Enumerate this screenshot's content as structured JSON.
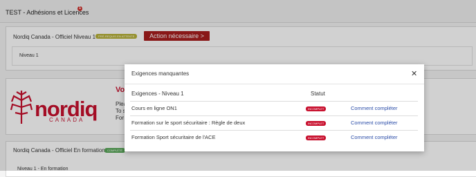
{
  "header": {
    "title": "TEST - Adhésions et Licences",
    "notif_count": "1"
  },
  "card1": {
    "title": "Nordiq Canada - Officiel Niveau 1",
    "badge": "PRÉ-REQUIS EN ATTENTE",
    "action_label": "Action nécessaire >",
    "sub_label": "Niveau 1"
  },
  "promo": {
    "logo_word": "nordiq",
    "logo_sub": "CANADA",
    "title_fragment": "Vo",
    "line1": "Plea",
    "line2": "To s",
    "line3": "For"
  },
  "card3": {
    "title": "Nordiq Canada - Officiel En formation",
    "badge": "COMPLÉTÉ",
    "sub_label": "Niveau 1 - En formation"
  },
  "modal": {
    "title": "Exigences manquantes",
    "col_requirements": "Exigences - Niveau 1",
    "col_status": "Statut",
    "rows": [
      {
        "label": "Cours en ligne ON1",
        "status": "INCOMPLET",
        "link": "Comment compléter"
      },
      {
        "label": "Formation sur le sport sécuritaire : Règle de deux",
        "status": "INCOMPLET",
        "link": "Comment compléter"
      },
      {
        "label": "Formation Sport sécuritaire de l'ACE",
        "status": "INCOMPLET",
        "link": "Comment compléter"
      }
    ]
  },
  "colors": {
    "brand_red": "#c8102e",
    "link_blue": "#2b4da8",
    "wait_badge": "#b7b13a",
    "complete_badge": "#5aa85a"
  },
  "icons": {
    "close": "close-icon",
    "logo": "maple-leaf-icon"
  }
}
